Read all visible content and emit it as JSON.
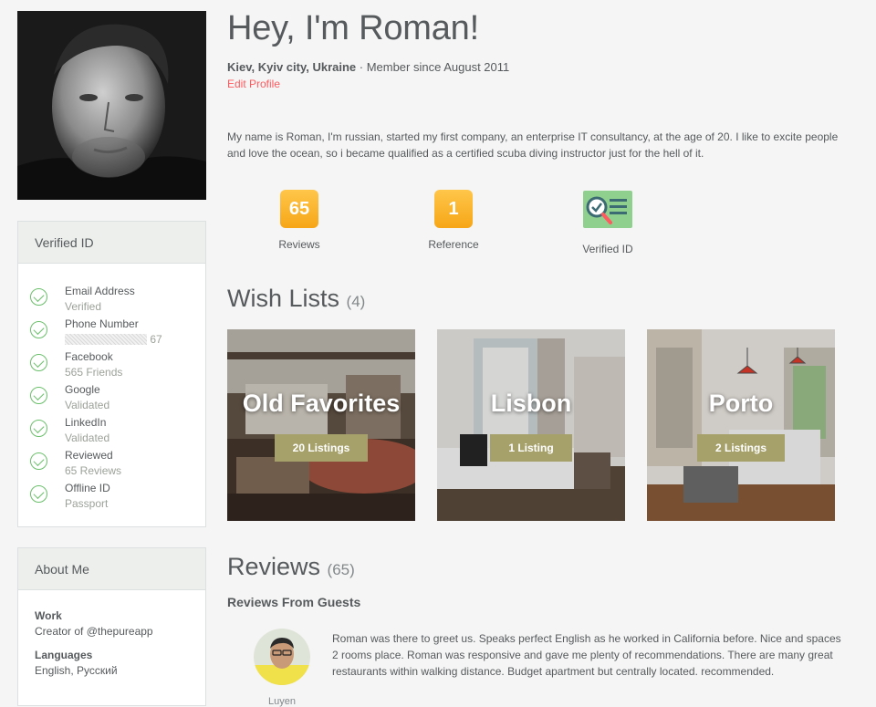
{
  "profile": {
    "title": "Hey, I'm Roman!",
    "location": "Kiev, Kyiv city, Ukraine",
    "member_since": " · Member since August 2011",
    "edit_label": "Edit Profile",
    "bio": "My name is Roman, I'm russian, started my first company, an enterprise IT consultancy, at the age of 20. I like to excite people and love the ocean, so i became qualified as a certified scuba diving instructor just for the hell of it."
  },
  "stats": [
    {
      "value": "65",
      "label": "Reviews"
    },
    {
      "value": "1",
      "label": "Reference"
    },
    {
      "icon": "verified-id-icon",
      "label": "Verified ID"
    }
  ],
  "verified": {
    "heading": "Verified ID",
    "items": [
      {
        "name": "Email Address",
        "status": "Verified"
      },
      {
        "name": "Phone Number",
        "status": "67"
      },
      {
        "name": "Facebook",
        "status": "565 Friends"
      },
      {
        "name": "Google",
        "status": "Validated"
      },
      {
        "name": "LinkedIn",
        "status": "Validated"
      },
      {
        "name": "Reviewed",
        "status": "65 Reviews"
      },
      {
        "name": "Offline ID",
        "status": "Passport"
      }
    ]
  },
  "about": {
    "heading": "About Me",
    "work_label": "Work",
    "work_value": "Creator of @thepureapp",
    "languages_label": "Languages",
    "languages_value": "English, Русский"
  },
  "wishlists": {
    "heading": "Wish Lists",
    "count": "(4)",
    "items": [
      {
        "name": "Old Favorites",
        "listings": "20 Listings"
      },
      {
        "name": "Lisbon",
        "listings": "1 Listing"
      },
      {
        "name": "Porto",
        "listings": "2 Listings"
      }
    ]
  },
  "reviews": {
    "heading": "Reviews",
    "count": "(65)",
    "subheading": "Reviews From Guests",
    "items": [
      {
        "reviewer": "Luyen",
        "text": "Roman was there to greet us. Speaks perfect English as he worked in California before. Nice and spaces 2 rooms place. Roman was responsive and gave me plenty of recommendations. There are many great restaurants within walking distance. Budget apartment but centrally located. recommended."
      }
    ]
  },
  "colors": {
    "accent": "#ff5a5f",
    "badge": "#f6a617",
    "check": "#6bbf6b",
    "pill": "#a6a16a"
  }
}
